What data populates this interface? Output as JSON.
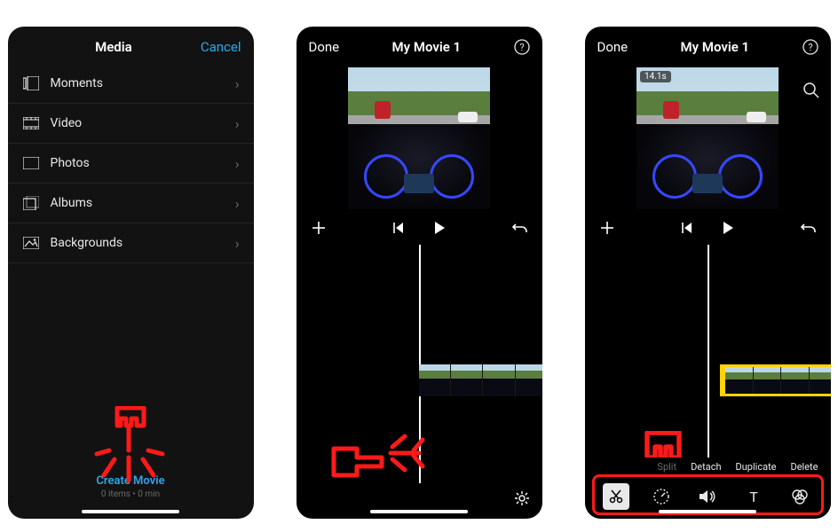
{
  "screen1": {
    "title": "Media",
    "cancel": "Cancel",
    "items": [
      {
        "label": "Moments"
      },
      {
        "label": "Video"
      },
      {
        "label": "Photos"
      },
      {
        "label": "Albums"
      },
      {
        "label": "Backgrounds"
      }
    ],
    "create_label": "Create Movie",
    "create_sub": "0 items • 0 min"
  },
  "screen2": {
    "done": "Done",
    "title": "My Movie 1"
  },
  "screen3": {
    "done": "Done",
    "title": "My Movie 1",
    "timestamp": "14.1s",
    "actions": {
      "split": "Split",
      "detach": "Detach",
      "duplicate": "Duplicate",
      "delete": "Delete"
    }
  }
}
